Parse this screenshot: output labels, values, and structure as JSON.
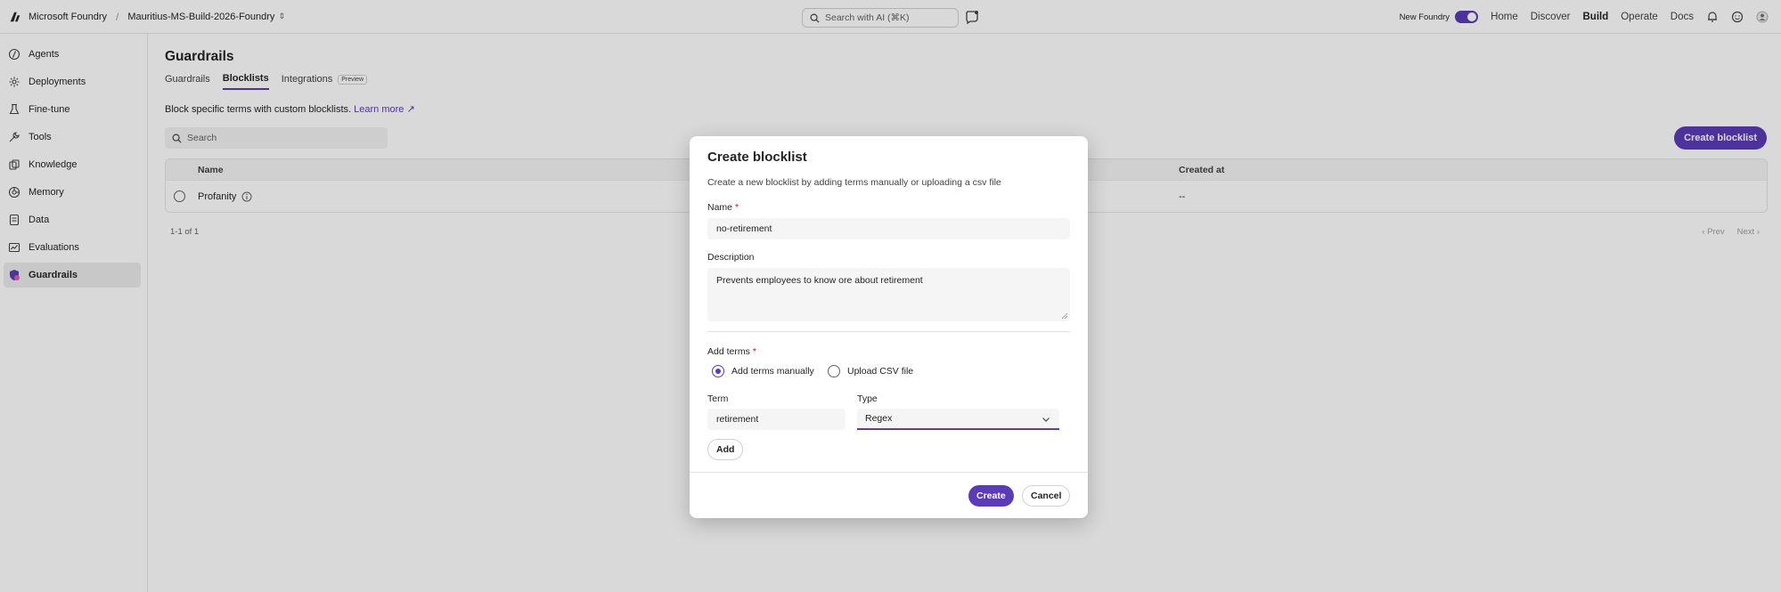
{
  "topbar": {
    "brand": "Microsoft Foundry",
    "separator": "/",
    "project": "Mauritius-MS-Build-2026-Foundry",
    "search_placeholder": "Search with AI (⌘K)",
    "new_foundry_label": "New Foundry",
    "new_foundry_on": true,
    "nav": [
      "Home",
      "Discover",
      "Build",
      "Operate",
      "Docs"
    ],
    "active_nav": "Build"
  },
  "sidebar": {
    "items": [
      {
        "label": "Agents",
        "icon": "agents-icon"
      },
      {
        "label": "Deployments",
        "icon": "deployments-icon"
      },
      {
        "label": "Fine-tune",
        "icon": "fine-tune-icon"
      },
      {
        "label": "Tools",
        "icon": "tools-icon"
      },
      {
        "label": "Knowledge",
        "icon": "knowledge-icon"
      },
      {
        "label": "Memory",
        "icon": "memory-icon"
      },
      {
        "label": "Data",
        "icon": "data-icon"
      },
      {
        "label": "Evaluations",
        "icon": "evaluations-icon"
      },
      {
        "label": "Guardrails",
        "icon": "guardrails-icon"
      }
    ],
    "active": "Guardrails"
  },
  "main": {
    "title": "Guardrails",
    "tabs": [
      {
        "label": "Guardrails"
      },
      {
        "label": "Blocklists"
      },
      {
        "label": "Integrations",
        "badge": "Preview"
      }
    ],
    "active_tab": "Blocklists",
    "description": "Block specific terms with custom blocklists.",
    "learn_more": "Learn more",
    "search_placeholder": "Search",
    "create_button": "Create blocklist",
    "table": {
      "columns": [
        "Name",
        "Created at"
      ],
      "rows": [
        {
          "name": "Profanity",
          "created_at": "--"
        }
      ]
    },
    "pager_count": "1-1 of 1",
    "prev": "Prev",
    "next": "Next"
  },
  "dialog": {
    "title": "Create blocklist",
    "subtitle": "Create a new blocklist by adding terms manually or uploading a csv file",
    "name_label": "Name",
    "name_value": "no-retirement",
    "description_label": "Description",
    "description_value": "Prevents employees to know ore about retirement",
    "add_terms_label": "Add terms",
    "required_marker": "*",
    "options": [
      "Add terms manually",
      "Upload CSV file"
    ],
    "selected_option": "Add terms manually",
    "term_label": "Term",
    "term_value": "retirement",
    "type_label": "Type",
    "type_value": "Regex",
    "add_button": "Add",
    "create_button": "Create",
    "cancel_button": "Cancel"
  },
  "colors": {
    "accent": "#5b3bb8",
    "required": "#c50f1f",
    "overlay": "rgba(0,0,0,0.15)"
  }
}
